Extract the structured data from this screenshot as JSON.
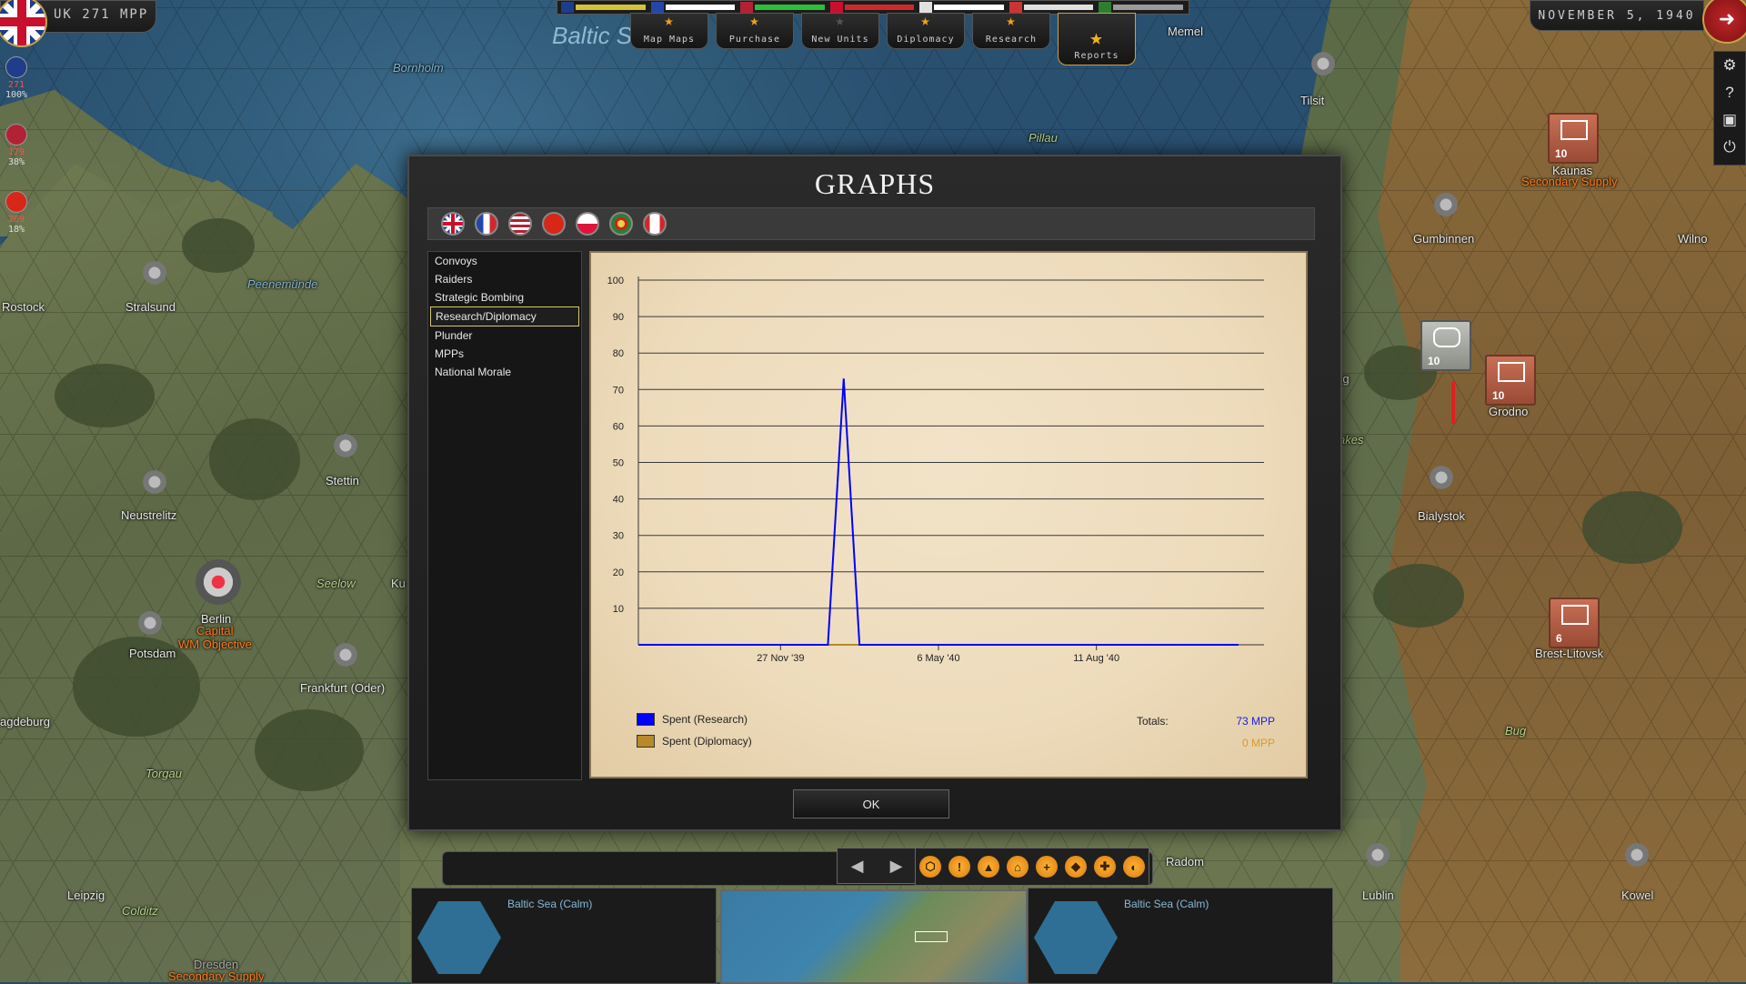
{
  "hud": {
    "mpp_label": "UK 271 MPP",
    "date": "NOVEMBER 5, 1940",
    "side_stats": [
      {
        "v1": "271",
        "v2": "100%",
        "color": "#c8102e"
      },
      {
        "v1": "179",
        "v2": "38%",
        "color": "#b22234"
      },
      {
        "v1": "269",
        "v2": "18%",
        "color": "#d62718"
      }
    ],
    "right_tools": [
      "gear-icon",
      "help-icon",
      "save-icon",
      "power-icon"
    ]
  },
  "top_menu": [
    {
      "label": "Map Maps",
      "name": "map-maps-button",
      "active": false
    },
    {
      "label": "Purchase",
      "name": "purchase-button",
      "active": false
    },
    {
      "label": "New Units",
      "name": "new-units-button",
      "active": false
    },
    {
      "label": "Diplomacy",
      "name": "diplomacy-button",
      "active": false
    },
    {
      "label": "Research",
      "name": "research-button",
      "active": false
    },
    {
      "label": "Reports",
      "name": "reports-button",
      "active": true
    }
  ],
  "flag_bar_colors": [
    "#d4c23a",
    "#ffffff",
    "#2bbf3a",
    "#d0282a",
    "#ffffff",
    "#e0e0e0",
    "#9a9a9a"
  ],
  "map_labels": {
    "sea": "Baltic S",
    "cities": [
      "Rostock",
      "Stralsund",
      "Peenemünde",
      "Stettin",
      "Neustrelitz",
      "Berlin",
      "Capital",
      "WM Objective",
      "Potsdam",
      "Seelow",
      "Frankfurt (Oder)",
      "agdeburg",
      "Torgau",
      "Leipzig",
      "Colditz",
      "Dresden",
      "Secondary Supply",
      "Memel",
      "Tilsit",
      "Pillau",
      "Gumbinnen",
      "Kaunas",
      "Secondary Supply",
      "Wilno",
      "Grodno",
      "Bialystok",
      "Brest-Litovsk",
      "Bug",
      "Radom",
      "Lublin",
      "Kowel",
      "Bornholm",
      "rg",
      "akes",
      "Ku"
    ],
    "units": [
      {
        "str": "10"
      },
      {
        "str": "10"
      },
      {
        "str": "10"
      },
      {
        "str": "6"
      }
    ]
  },
  "dialog": {
    "title": "GRAPHS",
    "nations": [
      {
        "name": "uk",
        "color": "#1f3d8a"
      },
      {
        "name": "france",
        "color": "#2546a8"
      },
      {
        "name": "usa",
        "color": "#b22234"
      },
      {
        "name": "china",
        "color": "#d62718"
      },
      {
        "name": "poland",
        "color": "#e8e8e8"
      },
      {
        "name": "portugal-free",
        "color": "#2e7d32"
      },
      {
        "name": "canada",
        "color": "#ffffff"
      }
    ],
    "nav_items": [
      {
        "label": "Convoys",
        "selected": false
      },
      {
        "label": "Raiders",
        "selected": false
      },
      {
        "label": "Strategic Bombing",
        "selected": false
      },
      {
        "label": "Research/Diplomacy",
        "selected": true
      },
      {
        "label": "Plunder",
        "selected": false
      },
      {
        "label": "MPPs",
        "selected": false
      },
      {
        "label": "National Morale",
        "selected": false
      }
    ],
    "ok_label": "OK",
    "totals_label": "Totals:"
  },
  "chart_data": {
    "type": "line",
    "title": "",
    "xlabel": "",
    "ylabel": "",
    "ylim": [
      0,
      100
    ],
    "yticks": [
      10,
      20,
      30,
      40,
      50,
      60,
      70,
      80,
      90,
      100
    ],
    "x_tick_labels": [
      {
        "label": "27 Nov '39",
        "at": 10
      },
      {
        "label": "6 May '40",
        "at": 20
      },
      {
        "label": "11 Aug '40",
        "at": 30
      }
    ],
    "x_range": [
      1,
      39
    ],
    "grid": true,
    "series": [
      {
        "name": "Spent (Research)",
        "color": "#0000ff",
        "points": [
          [
            1,
            0
          ],
          [
            13,
            0
          ],
          [
            14,
            73
          ],
          [
            15,
            0
          ],
          [
            39,
            0
          ]
        ],
        "total": "73 MPP",
        "total_color": "#1a22e8"
      },
      {
        "name": "Spent (Diplomacy)",
        "color": "#b8892b",
        "points": [
          [
            1,
            0
          ],
          [
            39,
            0
          ]
        ],
        "total": "0 MPP",
        "total_color": "#d99a2a"
      }
    ]
  },
  "bottom": {
    "left_label": "Baltic Sea (Calm)",
    "right_label": "Baltic Sea (Calm)"
  }
}
